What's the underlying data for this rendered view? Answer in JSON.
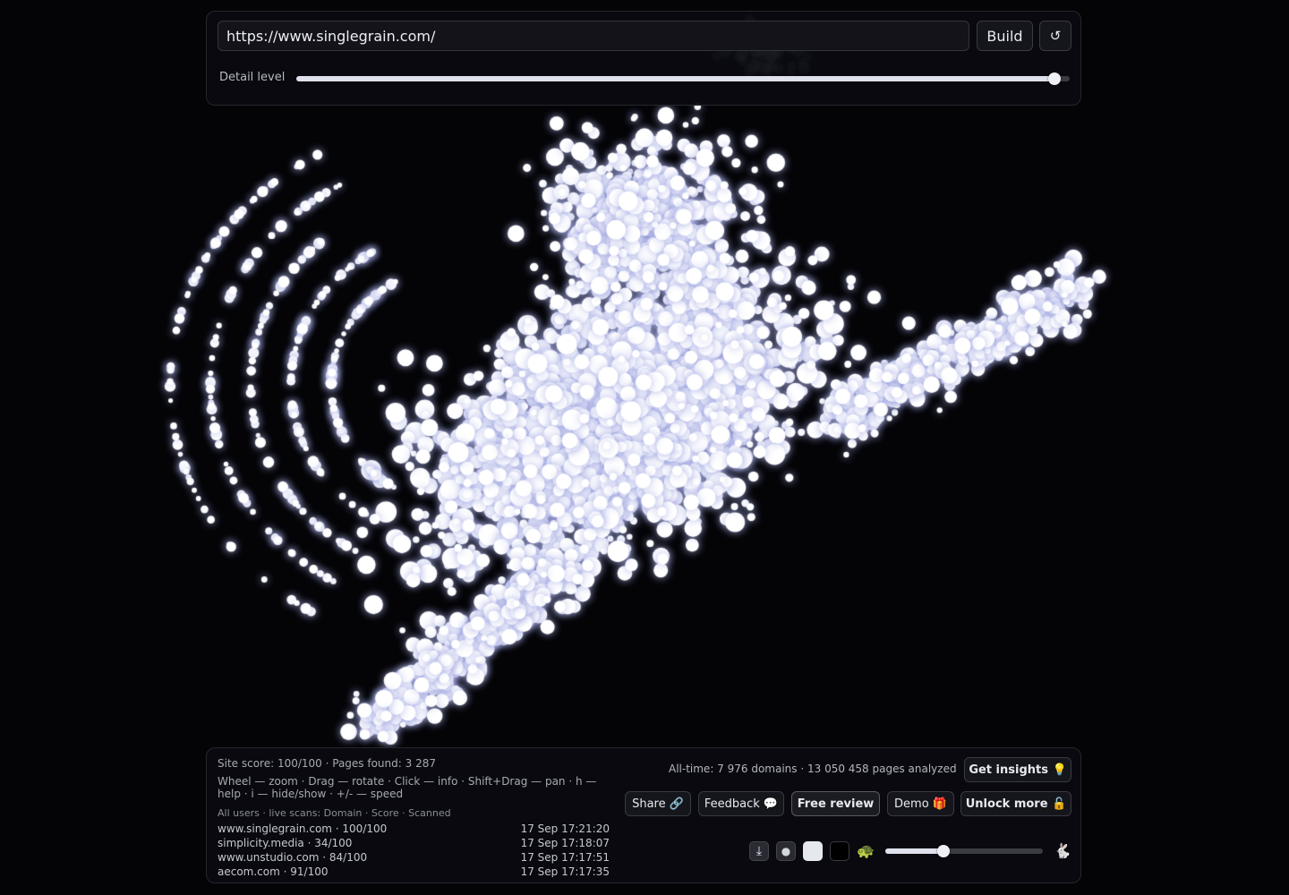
{
  "toolbar": {
    "url_value": "https://www.singlegrain.com/",
    "build_label": "Build",
    "refresh_label": "↺",
    "detail_label": "Detail level",
    "detail_level": 0.98
  },
  "info": {
    "site_score": "Site score: 100/100 · Pages found: 3 287",
    "help": "Wheel — zoom · Drag — rotate · Click — info · Shift+Drag — pan · h — help · i — hide/show · +/- — speed",
    "scans_header": "All users · live scans: Domain · Score · Scanned",
    "scans": [
      {
        "domain": "www.singlegrain.com · 100/100",
        "time": "17 Sep 17:21:20"
      },
      {
        "domain": "simplicity.media · 34/100",
        "time": "17 Sep 17:18:07"
      },
      {
        "domain": "www.unstudio.com · 84/100",
        "time": "17 Sep 17:17:51"
      },
      {
        "domain": "aecom.com · 91/100",
        "time": "17 Sep 17:17:35"
      }
    ]
  },
  "actions": {
    "alltime": "All-time: 7 976 domains · 13 050 458 pages analyzed",
    "insights_label": "Get insights 💡",
    "share_label": "Share 🔗",
    "feedback_label": "Feedback 💬",
    "review_label": "Free review",
    "demo_label": "Demo 🎁",
    "unlock_label": "Unlock more 🔓"
  },
  "controls": {
    "download_icon": "⤓",
    "dot_icon": "●",
    "turtle_icon": "🐢",
    "rabbit_icon": "🐇",
    "speed_level": 0.37
  }
}
